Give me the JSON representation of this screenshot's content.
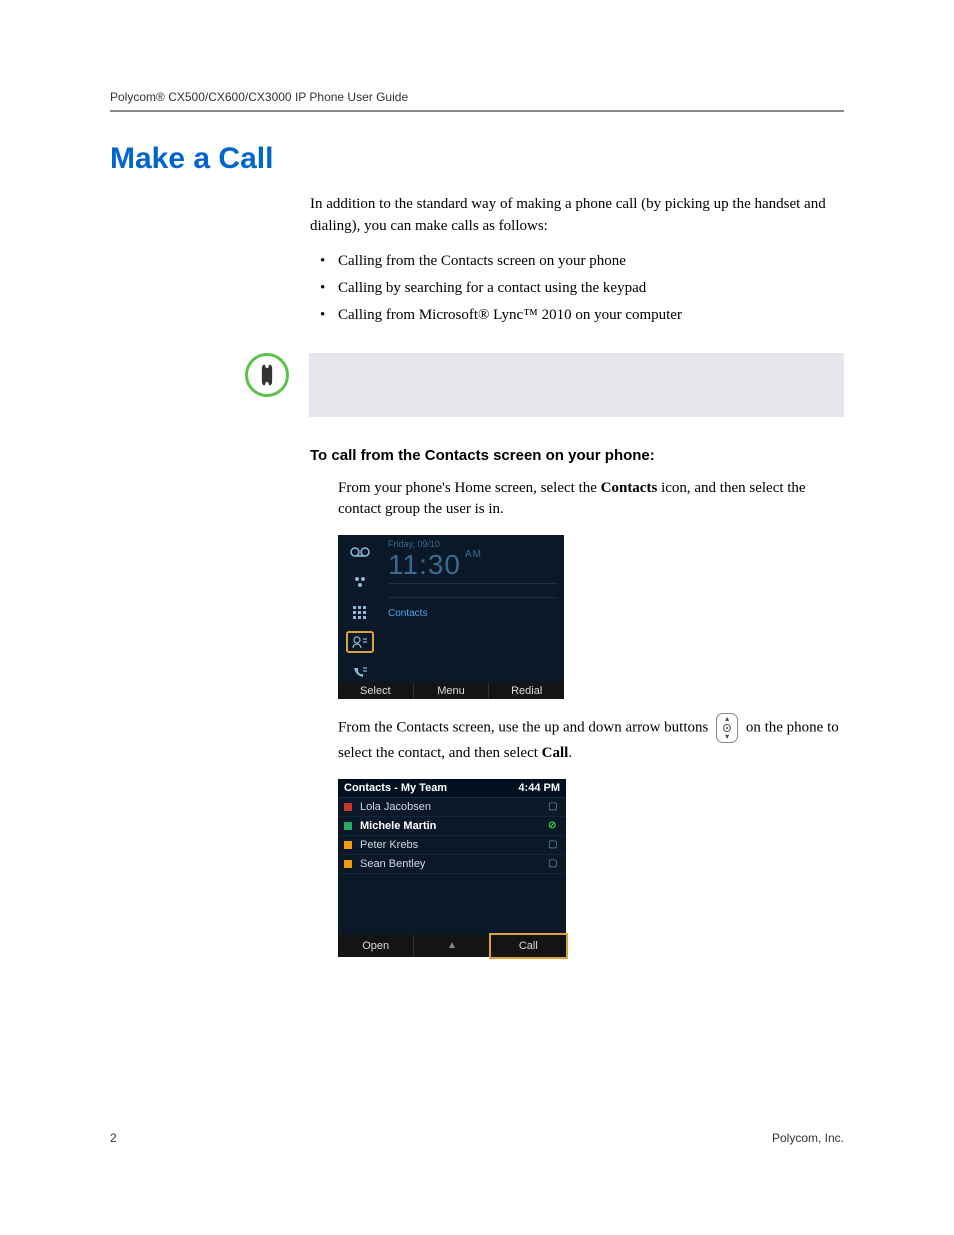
{
  "header": "Polycom® CX500/CX600/CX3000 IP Phone User Guide",
  "title": "Make a Call",
  "intro": "In addition to the standard way of making a phone call (by picking up the handset and dialing), you can make calls as follows:",
  "bullets": [
    "Calling from the Contacts screen on your phone",
    "Calling by searching for a contact using the keypad",
    "Calling from Microsoft® Lync™ 2010 on your computer"
  ],
  "sub_heading": "To call from the Contacts screen on your phone:",
  "step1_a": "From your phone's Home screen, select the ",
  "step1_bold": "Contacts",
  "step1_b": " icon, and then select the contact group the user is in.",
  "phone1": {
    "date": "Friday, 09/10",
    "time": "11:30",
    "ampm": "AM",
    "selected_label": "Contacts",
    "softkeys": [
      "Select",
      "Menu",
      "Redial"
    ]
  },
  "step2_a": "From the Contacts screen, use the up and down arrow buttons ",
  "step2_b": " on the phone to select the contact, and then select ",
  "step2_bold": "Call",
  "step2_c": ".",
  "phone2": {
    "title": "Contacts - My Team",
    "time": "4:44 PM",
    "rows": [
      {
        "name": "Lola Jacobsen",
        "presence": "busy",
        "selected": false,
        "status": "office"
      },
      {
        "name": "Michele Martin",
        "presence": "avail",
        "selected": true,
        "status": "dnd"
      },
      {
        "name": "Peter Krebs",
        "presence": "away",
        "selected": false,
        "status": "office"
      },
      {
        "name": "Sean Bentley",
        "presence": "away",
        "selected": false,
        "status": "office"
      }
    ],
    "softkeys": [
      "Open",
      "",
      "Call"
    ]
  },
  "footer": {
    "page": "2",
    "company": "Polycom, Inc."
  }
}
